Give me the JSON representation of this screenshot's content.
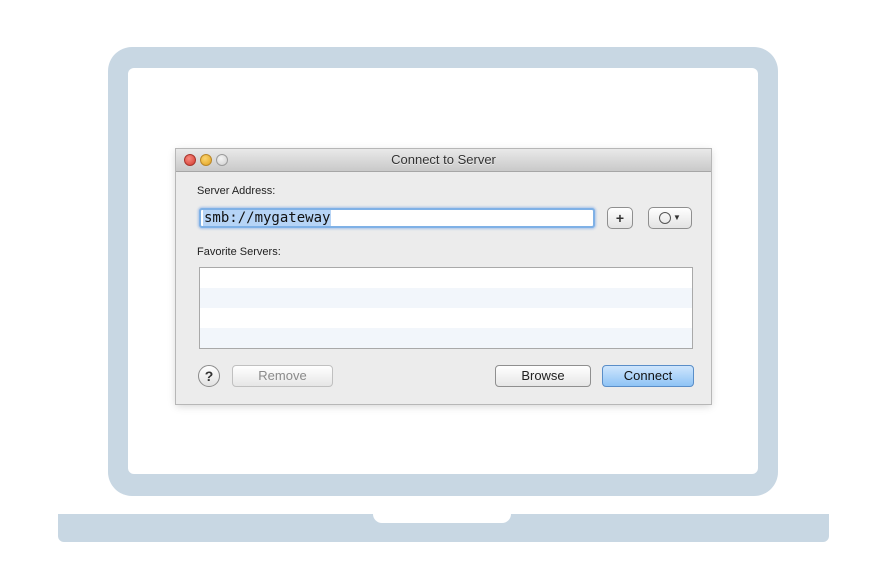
{
  "window": {
    "title": "Connect to Server"
  },
  "server_address": {
    "label": "Server Address:",
    "value": "smb://mygateway"
  },
  "favorites": {
    "label": "Favorite Servers:",
    "items": []
  },
  "buttons": {
    "add": "+",
    "help": "?",
    "remove": "Remove",
    "browse": "Browse",
    "connect": "Connect"
  },
  "icons": {
    "close": "close-icon",
    "minimize": "minimize-icon",
    "zoom": "zoom-icon",
    "recent": "clock-icon",
    "dropdown": "chevron-down-icon"
  },
  "colors": {
    "laptop_frame": "#c8d7e3",
    "default_button": "#8ec3f5",
    "selection": "#b6d4f6",
    "focus_ring": "#7fb1e6"
  }
}
